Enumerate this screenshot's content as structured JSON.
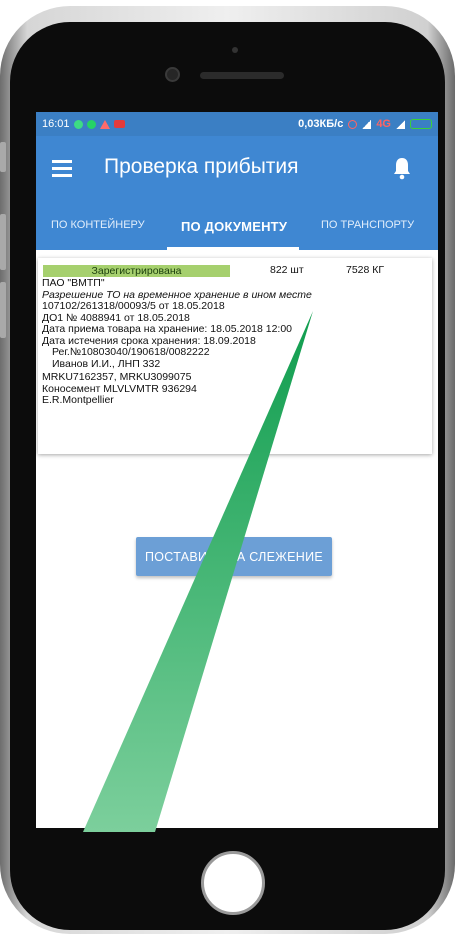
{
  "status_bar": {
    "time": "16:01",
    "net_speed": "0,03КБ/с",
    "network": "4G",
    "colors": {
      "whatsapp": "#3ddc84",
      "alert": "#ff6b6b",
      "youtube": "#e33b3b",
      "battery": "#3ad13a"
    }
  },
  "app_bar": {
    "title": "Проверка прибытия",
    "menu_icon": "hamburger-menu-icon",
    "bell_icon": "notification-bell-icon",
    "color": "#3f87d2"
  },
  "tabs": [
    {
      "label": "ПО КОНТЕЙНЕРУ",
      "active": false
    },
    {
      "label": "ПО ДОКУМЕНТУ",
      "active": true
    },
    {
      "label": "ПО ТРАНСПОРТУ",
      "active": false
    }
  ],
  "card": {
    "status": "Зарегистрирована",
    "status_color": "#a6d06e",
    "quantity": "822 шт",
    "weight": "7528 КГ",
    "company": "ПАО \"ВМТП\"",
    "permit": "Разрешение ТО на временное хранение в ином месте",
    "permit_number": "107102/261318/00093/5 от 18.05.2018",
    "do1": "ДО1 № 4088941 от 18.05.2018",
    "acceptance_date": "Дата приема товара на хранение: 18.05.2018 12:00",
    "expiry_date": "Дата истечения срока хранения: 18.09.2018",
    "reg_number": "Рег.№10803040/190618/0082222",
    "inspector": "Иванов И.И., ЛНП 332",
    "containers": "MRKU7162357, MRKU3099075",
    "bill_of_lading": "Коносемент MLVLVMTR 936294",
    "vessel": "E.R.Montpellier"
  },
  "track_button": {
    "label": "ПОСТАВИТЬ НА СЛЕЖЕНИЕ",
    "color": "#6c9fd6"
  },
  "annotation": {
    "type": "green-triangle-pointer",
    "color": "#1aa85a"
  }
}
